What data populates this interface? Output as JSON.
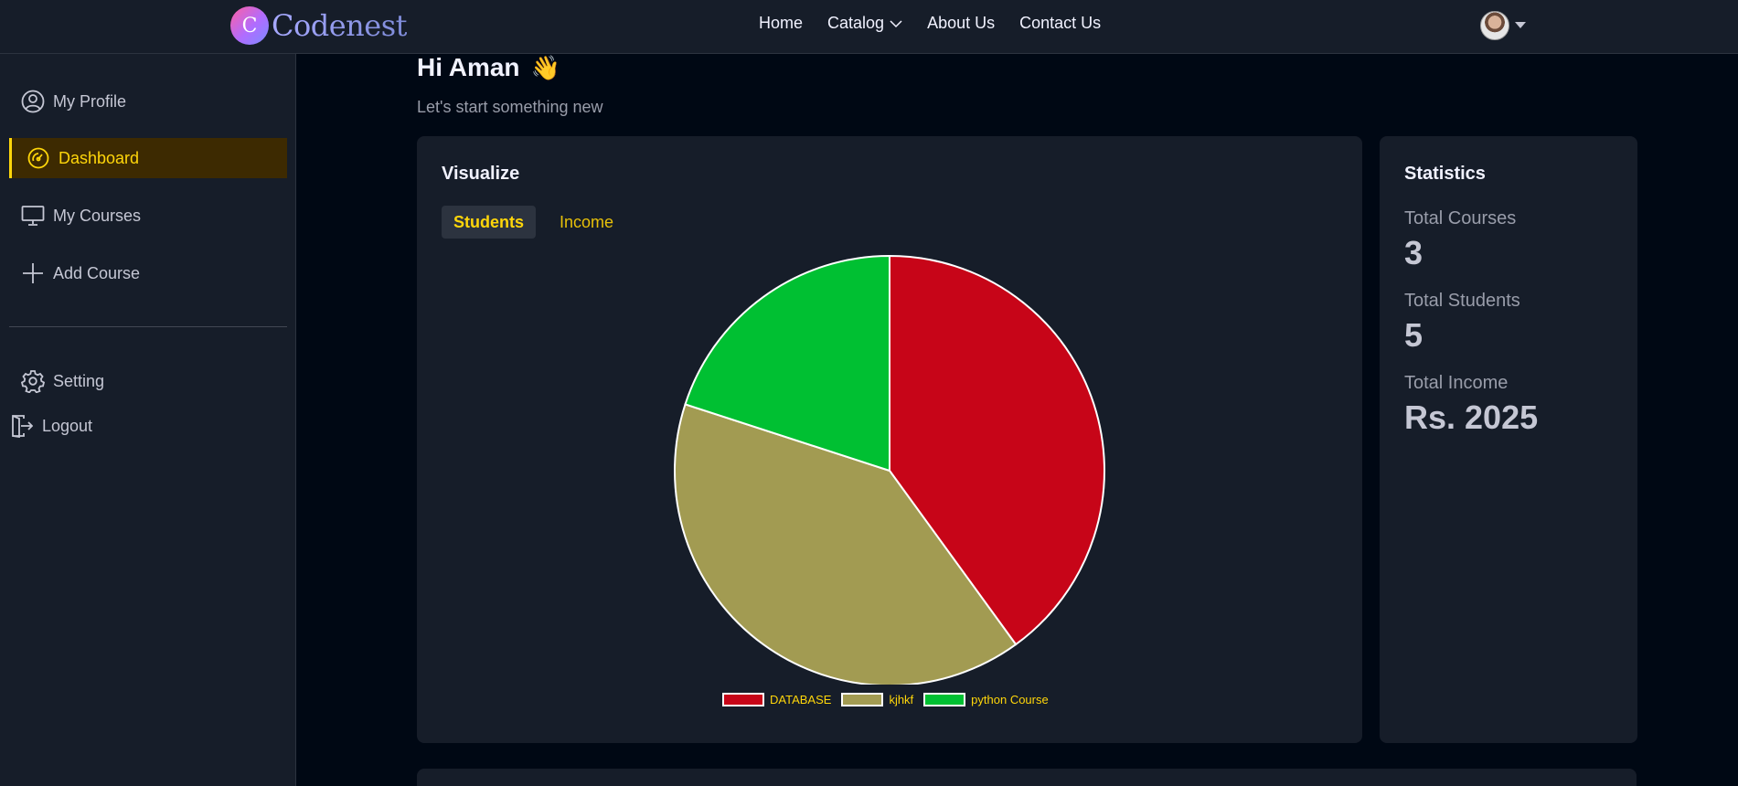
{
  "brand": {
    "badge": "C",
    "name": "Codenest"
  },
  "nav": {
    "links": [
      {
        "label": "Home"
      },
      {
        "label": "Catalog",
        "has_dropdown": true
      },
      {
        "label": "About Us"
      },
      {
        "label": "Contact Us"
      }
    ]
  },
  "sidebar": {
    "items": [
      {
        "label": "My Profile",
        "icon": "user-circle-icon"
      },
      {
        "label": "Dashboard",
        "icon": "gauge-icon",
        "active": true
      },
      {
        "label": "My Courses",
        "icon": "monitor-icon"
      },
      {
        "label": "Add Course",
        "icon": "plus-icon"
      },
      {
        "label": "Setting",
        "icon": "gear-icon"
      },
      {
        "label": "Logout",
        "icon": "logout-icon"
      }
    ]
  },
  "main": {
    "greeting": "Hi Aman",
    "greeting_emoji": "👋",
    "subtitle": "Let's start something new"
  },
  "visualize": {
    "title": "Visualize",
    "tabs": [
      {
        "label": "Students",
        "active": true
      },
      {
        "label": "Income"
      }
    ]
  },
  "statistics": {
    "title": "Statistics",
    "items": [
      {
        "label": "Total Courses",
        "value": "3"
      },
      {
        "label": "Total Students",
        "value": "5"
      },
      {
        "label": "Total Income",
        "value": "Rs. 2025"
      }
    ]
  },
  "colors": {
    "accent": "#ffd60a",
    "bg": "#000814",
    "panel": "#161d29",
    "active_bg": "#3d2a01"
  },
  "chart_data": {
    "type": "pie",
    "categories": [
      "DATABASE",
      "kjhkf",
      "python Course"
    ],
    "values": [
      2,
      2,
      1
    ],
    "colors": [
      "#c70518",
      "#a29b52",
      "#00c032"
    ],
    "legend_position": "bottom"
  }
}
